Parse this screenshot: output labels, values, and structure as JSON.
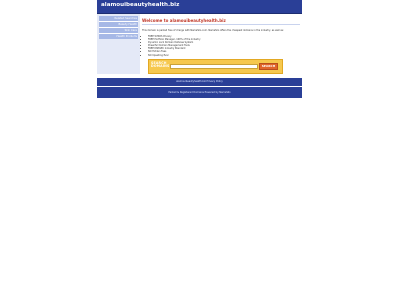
{
  "site": {
    "title": "alamouibeautyhealth.biz"
  },
  "sidebar": {
    "items": [
      {
        "label": "Related Searches"
      },
      {
        "label": "Beauty Health"
      },
      {
        "label": "Skin Care"
      },
      {
        "label": "Health Products"
      }
    ]
  },
  "content": {
    "welcome": "Welcome to alamouibeautyhealth.biz",
    "intro": "This domain is parked free of charge with NameSilo.com. NameSilo offers the cheapest domains in the industry, as well as:",
    "features": [
      "FREE WHOIS Privacy",
      "FREE Portfolio Manager, 100% of the Industry",
      "Dynamic Lock Domain Defense System",
      "Powerful Domain Management Tools",
      "FREE DNSSEC Industry Standard",
      "NO Hidden Fees",
      "NO Upselling Ever"
    ]
  },
  "search": {
    "label": "SEARCH DOMAINS",
    "placeholder": "",
    "button_label": "SEARCH"
  },
  "footer": {
    "links_text": "alamouibeautyhealth.biz   Privacy Policy",
    "powered_text": "Parked & Registered Domains Powered by NameSilo"
  }
}
